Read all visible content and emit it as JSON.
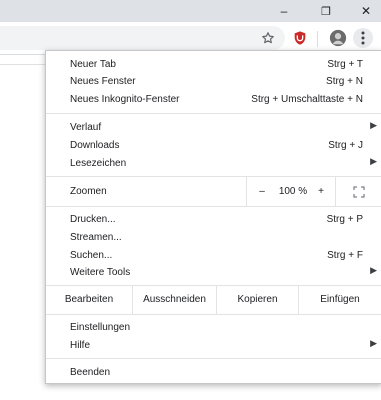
{
  "window_controls": {
    "minimize": "–",
    "restore": "❐",
    "close": "✕"
  },
  "toolbar": {
    "icons": [
      "star-icon",
      "ublock-shield-icon",
      "profile-avatar",
      "more-menu-icon"
    ],
    "accent_shield": "#cc2a2a"
  },
  "menu": {
    "new_tab": {
      "label": "Neuer Tab",
      "shortcut": "Strg + T"
    },
    "new_window": {
      "label": "Neues Fenster",
      "shortcut": "Strg + N"
    },
    "new_incognito": {
      "label": "Neues Inkognito-Fenster",
      "shortcut": "Strg + Umschalttaste + N"
    },
    "history": {
      "label": "Verlauf",
      "arrow": "▶"
    },
    "downloads": {
      "label": "Downloads",
      "shortcut": "Strg + J"
    },
    "bookmarks": {
      "label": "Lesezeichen",
      "arrow": "▶"
    },
    "zoom": {
      "label": "Zoomen",
      "minus": "–",
      "level": "100 %",
      "plus": "+",
      "fullscreen": "⛶"
    },
    "print": {
      "label": "Drucken...",
      "shortcut": "Strg + P"
    },
    "cast": {
      "label": "Streamen..."
    },
    "find": {
      "label": "Suchen...",
      "shortcut": "Strg + F"
    },
    "more_tools": {
      "label": "Weitere Tools",
      "arrow": "▶"
    },
    "edit": {
      "label": "Bearbeiten",
      "cut": "Ausschneiden",
      "copy": "Kopieren",
      "paste": "Einfügen"
    },
    "settings": {
      "label": "Einstellungen"
    },
    "help": {
      "label": "Hilfe",
      "arrow": "▶"
    },
    "exit": {
      "label": "Beenden"
    }
  }
}
